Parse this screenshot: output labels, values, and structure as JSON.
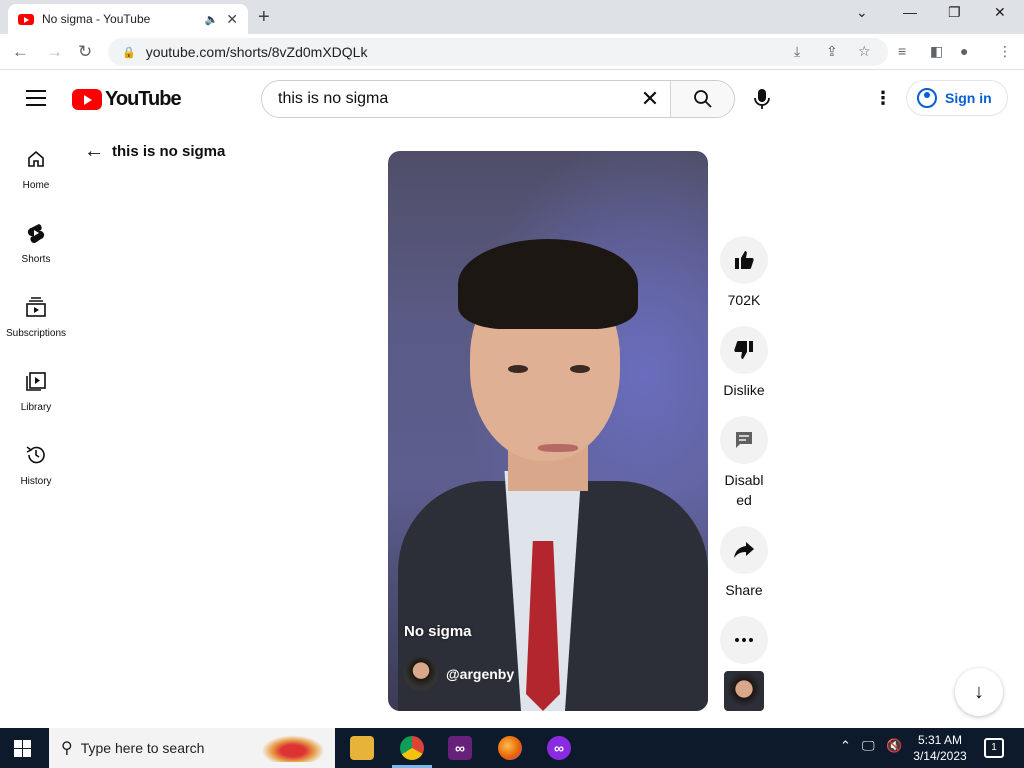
{
  "browser": {
    "tab_title": "No sigma - YouTube",
    "url": "youtube.com/shorts/8vZd0mXDQLk"
  },
  "header": {
    "logo_text": "YouTube",
    "search_value": "this is no sigma",
    "signin_label": "Sign in"
  },
  "sidebar": {
    "items": [
      {
        "label": "Home",
        "icon": "home-icon"
      },
      {
        "label": "Shorts",
        "icon": "shorts-icon"
      },
      {
        "label": "Subscriptions",
        "icon": "subscriptions-icon"
      },
      {
        "label": "Library",
        "icon": "library-icon"
      },
      {
        "label": "History",
        "icon": "history-icon"
      }
    ]
  },
  "back_label": "this is no sigma",
  "short": {
    "title": "No sigma",
    "channel": "@argenby"
  },
  "actions": {
    "like_count": "702K",
    "dislike_label": "Dislike",
    "comments_label": "Disabled",
    "share_label": "Share"
  },
  "taskbar": {
    "search_placeholder": "Type here to search",
    "time": "5:31 AM",
    "date": "3/14/2023",
    "notification_count": "1"
  },
  "colors": {
    "brand_red": "#ff0000",
    "link_blue": "#065fd4",
    "taskbar_bg": "#0c1a2b"
  }
}
